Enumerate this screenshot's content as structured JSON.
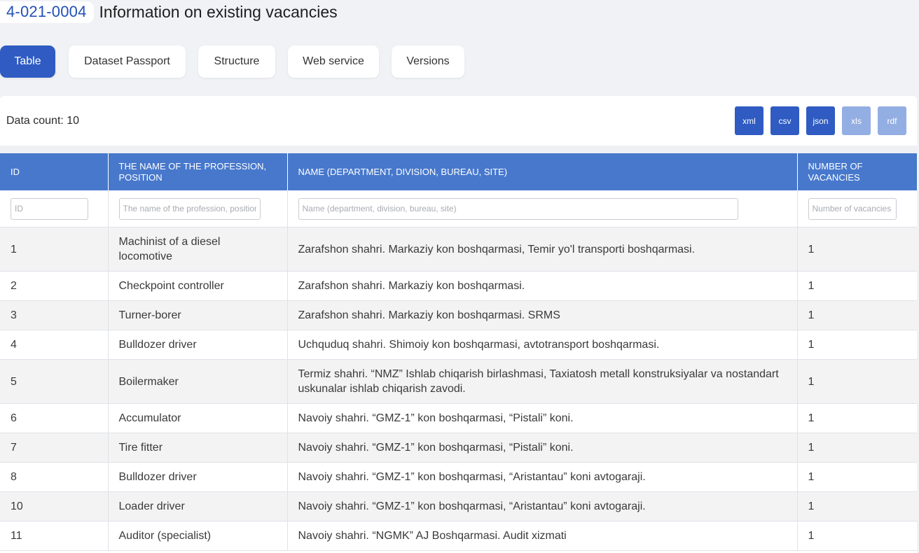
{
  "header": {
    "code": "4-021-0004",
    "title": "Information on existing vacancies"
  },
  "tabs": [
    {
      "label": "Table",
      "active": true
    },
    {
      "label": "Dataset Passport"
    },
    {
      "label": "Structure"
    },
    {
      "label": "Web service"
    },
    {
      "label": "Versions"
    }
  ],
  "data_count": "Data count: 10",
  "exports": [
    {
      "label": "xml",
      "enabled": true
    },
    {
      "label": "csv",
      "enabled": true
    },
    {
      "label": "json",
      "enabled": true
    },
    {
      "label": "xls",
      "enabled": false
    },
    {
      "label": "rdf",
      "enabled": false
    }
  ],
  "table": {
    "columns": [
      {
        "header": "ID",
        "placeholder": "ID"
      },
      {
        "header": "The name of the profession, position",
        "placeholder": "The name of the profession, position"
      },
      {
        "header": "Name (department, division, bureau, site)",
        "placeholder": "Name (department, division, bureau, site)"
      },
      {
        "header": "Number of vacancies",
        "placeholder": "Number of vacancies"
      }
    ],
    "rows": [
      [
        "1",
        "Machinist of a diesel locomotive",
        "Zarafshon shahri. Markaziy kon boshqarmasi, Temir yo'l transporti boshqarmasi.",
        "1"
      ],
      [
        "2",
        "Checkpoint controller",
        "Zarafshon shahri. Markaziy kon boshqarmasi.",
        "1"
      ],
      [
        "3",
        "Turner-borer",
        "Zarafshon shahri. Markaziy kon boshqarmasi. SRMS",
        "1"
      ],
      [
        "4",
        "Bulldozer driver",
        "Uchquduq shahri. Shimoiy kon boshqarmasi, avtotransport boshqarmasi.",
        "1"
      ],
      [
        "5",
        "Boilermaker",
        "Termiz shahri. “NMZ” Ishlab chiqarish birlashmasi, Taxiatosh metall konstruksiyalar va nostandart uskunalar ishlab chiqarish zavodi.",
        "1"
      ],
      [
        "6",
        "Accumulator",
        "Navoiy shahri. “GMZ-1” kon boshqarmasi, “Pistali” koni.",
        "1"
      ],
      [
        "7",
        "Tire fitter",
        "Navoiy shahri. “GMZ-1” kon boshqarmasi, “Pistali” koni.",
        "1"
      ],
      [
        "8",
        "Bulldozer driver",
        "Navoiy shahri. “GMZ-1” kon boshqarmasi, “Aristantau” koni avtogaraji.",
        "1"
      ],
      [
        "10",
        "Loader driver",
        "Navoiy shahri. “GMZ-1” kon boshqarmasi, “Aristantau” koni avtogaraji.",
        "1"
      ],
      [
        "11",
        "Auditor (specialist)",
        "Navoiy shahri. “NGMK” AJ Boshqarmasi. Audit xizmati",
        "1"
      ]
    ]
  }
}
